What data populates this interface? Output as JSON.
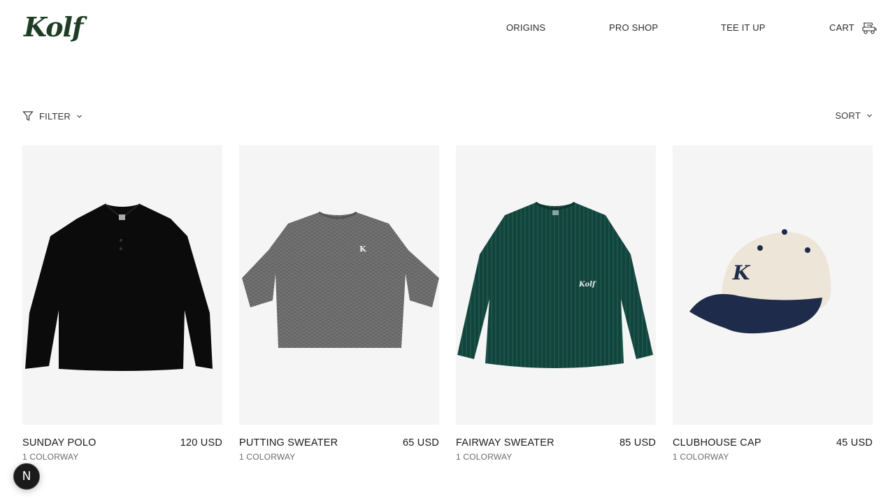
{
  "brand": {
    "logo_text": "Kolf"
  },
  "nav": {
    "items": [
      {
        "label": "ORIGINS"
      },
      {
        "label": "PRO SHOP"
      },
      {
        "label": "TEE IT UP"
      }
    ],
    "cart_label": "CART",
    "cart_icon": "golf-cart-icon"
  },
  "toolbar": {
    "filter_label": "FILTER",
    "filter_icon": "filter-funnel-icon",
    "sort_label": "SORT"
  },
  "products": [
    {
      "name": "SUNDAY POLO",
      "price": "120 USD",
      "colorways": "1 COLORWAY",
      "color": "#0d0d0d"
    },
    {
      "name": "PUTTING SWEATER",
      "price": "65 USD",
      "colorways": "1 COLORWAY",
      "color": "#6a6a6a"
    },
    {
      "name": "FAIRWAY SWEATER",
      "price": "85 USD",
      "colorways": "1 COLORWAY",
      "color": "#14473f"
    },
    {
      "name": "CLUBHOUSE CAP",
      "price": "45 USD",
      "colorways": "1 COLORWAY",
      "color": "#ece5d8"
    }
  ],
  "dev_badge": {
    "label": "N"
  },
  "colors": {
    "logo": "#1e3d24",
    "card_bg": "#f5f5f5",
    "cap_brim": "#1f2b4a"
  }
}
